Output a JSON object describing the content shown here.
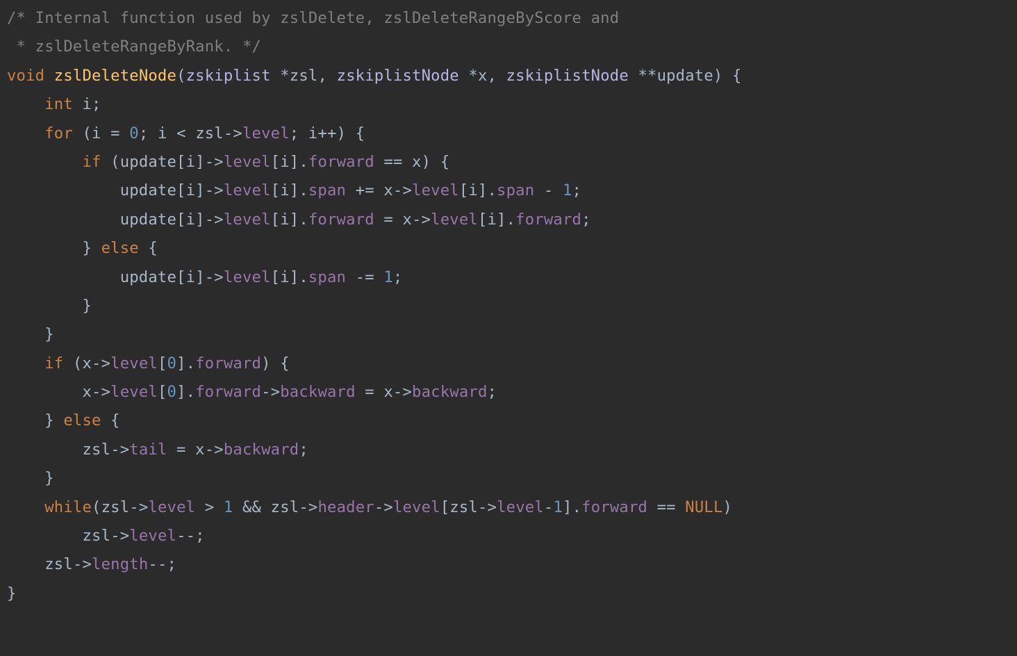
{
  "colors": {
    "background": "#2b2b2b",
    "default": "#a9b7c6",
    "comment": "#808080",
    "keyword": "#cc8242",
    "function": "#ffc66d",
    "type": "#b5b6e3",
    "field": "#9876aa",
    "number": "#6897bb"
  },
  "code": {
    "lines": [
      {
        "tokens": [
          {
            "cls": "comment",
            "t": "/* Internal function used by zslDelete, zslDeleteRangeByScore and"
          }
        ]
      },
      {
        "tokens": [
          {
            "cls": "comment",
            "t": " * zslDeleteRangeByRank. */"
          }
        ]
      },
      {
        "tokens": [
          {
            "cls": "kw",
            "t": "void"
          },
          {
            "cls": "base",
            "t": " "
          },
          {
            "cls": "fn",
            "t": "zslDeleteNode"
          },
          {
            "cls": "base",
            "t": "("
          },
          {
            "cls": "type",
            "t": "zskiplist"
          },
          {
            "cls": "base",
            "t": " *zsl, "
          },
          {
            "cls": "type",
            "t": "zskiplistNode"
          },
          {
            "cls": "base",
            "t": " *x, "
          },
          {
            "cls": "type",
            "t": "zskiplistNode"
          },
          {
            "cls": "base",
            "t": " **update) {"
          }
        ]
      },
      {
        "tokens": [
          {
            "cls": "base",
            "t": "    "
          },
          {
            "cls": "kw",
            "t": "int"
          },
          {
            "cls": "base",
            "t": " i;"
          }
        ]
      },
      {
        "tokens": [
          {
            "cls": "base",
            "t": "    "
          },
          {
            "cls": "kw",
            "t": "for"
          },
          {
            "cls": "base",
            "t": " (i = "
          },
          {
            "cls": "num",
            "t": "0"
          },
          {
            "cls": "base",
            "t": "; i < zsl->"
          },
          {
            "cls": "field",
            "t": "level"
          },
          {
            "cls": "base",
            "t": "; i++) {"
          }
        ]
      },
      {
        "tokens": [
          {
            "cls": "base",
            "t": "        "
          },
          {
            "cls": "kw",
            "t": "if"
          },
          {
            "cls": "base",
            "t": " (update[i]->"
          },
          {
            "cls": "field",
            "t": "level"
          },
          {
            "cls": "base",
            "t": "[i]."
          },
          {
            "cls": "field",
            "t": "forward"
          },
          {
            "cls": "base",
            "t": " == x) {"
          }
        ]
      },
      {
        "tokens": [
          {
            "cls": "base",
            "t": "            update[i]->"
          },
          {
            "cls": "field",
            "t": "level"
          },
          {
            "cls": "base",
            "t": "[i]."
          },
          {
            "cls": "field",
            "t": "span"
          },
          {
            "cls": "base",
            "t": " += x->"
          },
          {
            "cls": "field",
            "t": "level"
          },
          {
            "cls": "base",
            "t": "[i]."
          },
          {
            "cls": "field",
            "t": "span"
          },
          {
            "cls": "base",
            "t": " - "
          },
          {
            "cls": "num",
            "t": "1"
          },
          {
            "cls": "base",
            "t": ";"
          }
        ]
      },
      {
        "tokens": [
          {
            "cls": "base",
            "t": "            update[i]->"
          },
          {
            "cls": "field",
            "t": "level"
          },
          {
            "cls": "base",
            "t": "[i]."
          },
          {
            "cls": "field",
            "t": "forward"
          },
          {
            "cls": "base",
            "t": " = x->"
          },
          {
            "cls": "field",
            "t": "level"
          },
          {
            "cls": "base",
            "t": "[i]."
          },
          {
            "cls": "field",
            "t": "forward"
          },
          {
            "cls": "base",
            "t": ";"
          }
        ]
      },
      {
        "tokens": [
          {
            "cls": "base",
            "t": "        } "
          },
          {
            "cls": "kw",
            "t": "else"
          },
          {
            "cls": "base",
            "t": " {"
          }
        ]
      },
      {
        "tokens": [
          {
            "cls": "base",
            "t": "            update[i]->"
          },
          {
            "cls": "field",
            "t": "level"
          },
          {
            "cls": "base",
            "t": "[i]."
          },
          {
            "cls": "field",
            "t": "span"
          },
          {
            "cls": "base",
            "t": " -= "
          },
          {
            "cls": "num",
            "t": "1"
          },
          {
            "cls": "base",
            "t": ";"
          }
        ]
      },
      {
        "tokens": [
          {
            "cls": "base",
            "t": "        }"
          }
        ]
      },
      {
        "tokens": [
          {
            "cls": "base",
            "t": "    }"
          }
        ]
      },
      {
        "tokens": [
          {
            "cls": "base",
            "t": "    "
          },
          {
            "cls": "kw",
            "t": "if"
          },
          {
            "cls": "base",
            "t": " (x->"
          },
          {
            "cls": "field",
            "t": "level"
          },
          {
            "cls": "base",
            "t": "["
          },
          {
            "cls": "num",
            "t": "0"
          },
          {
            "cls": "base",
            "t": "]."
          },
          {
            "cls": "field",
            "t": "forward"
          },
          {
            "cls": "base",
            "t": ") {"
          }
        ]
      },
      {
        "tokens": [
          {
            "cls": "base",
            "t": "        x->"
          },
          {
            "cls": "field",
            "t": "level"
          },
          {
            "cls": "base",
            "t": "["
          },
          {
            "cls": "num",
            "t": "0"
          },
          {
            "cls": "base",
            "t": "]."
          },
          {
            "cls": "field",
            "t": "forward"
          },
          {
            "cls": "base",
            "t": "->"
          },
          {
            "cls": "field",
            "t": "backward"
          },
          {
            "cls": "base",
            "t": " = x->"
          },
          {
            "cls": "field",
            "t": "backward"
          },
          {
            "cls": "base",
            "t": ";"
          }
        ]
      },
      {
        "tokens": [
          {
            "cls": "base",
            "t": "    } "
          },
          {
            "cls": "kw",
            "t": "else"
          },
          {
            "cls": "base",
            "t": " {"
          }
        ]
      },
      {
        "tokens": [
          {
            "cls": "base",
            "t": "        zsl->"
          },
          {
            "cls": "field",
            "t": "tail"
          },
          {
            "cls": "base",
            "t": " = x->"
          },
          {
            "cls": "field",
            "t": "backward"
          },
          {
            "cls": "base",
            "t": ";"
          }
        ]
      },
      {
        "tokens": [
          {
            "cls": "base",
            "t": "    }"
          }
        ]
      },
      {
        "tokens": [
          {
            "cls": "base",
            "t": "    "
          },
          {
            "cls": "kw",
            "t": "while"
          },
          {
            "cls": "base",
            "t": "(zsl->"
          },
          {
            "cls": "field",
            "t": "level"
          },
          {
            "cls": "base",
            "t": " > "
          },
          {
            "cls": "num",
            "t": "1"
          },
          {
            "cls": "base",
            "t": " && zsl->"
          },
          {
            "cls": "field",
            "t": "header"
          },
          {
            "cls": "base",
            "t": "->"
          },
          {
            "cls": "field",
            "t": "level"
          },
          {
            "cls": "base",
            "t": "[zsl->"
          },
          {
            "cls": "field",
            "t": "level"
          },
          {
            "cls": "base",
            "t": "-"
          },
          {
            "cls": "num",
            "t": "1"
          },
          {
            "cls": "base",
            "t": "]."
          },
          {
            "cls": "field",
            "t": "forward"
          },
          {
            "cls": "base",
            "t": " == "
          },
          {
            "cls": "null",
            "t": "NULL"
          },
          {
            "cls": "base",
            "t": ")"
          }
        ]
      },
      {
        "tokens": [
          {
            "cls": "base",
            "t": "        zsl->"
          },
          {
            "cls": "field",
            "t": "level"
          },
          {
            "cls": "base",
            "t": "--;"
          }
        ]
      },
      {
        "tokens": [
          {
            "cls": "base",
            "t": "    zsl->"
          },
          {
            "cls": "field",
            "t": "length"
          },
          {
            "cls": "base",
            "t": "--;"
          }
        ]
      },
      {
        "tokens": [
          {
            "cls": "base",
            "t": "}"
          }
        ]
      }
    ]
  }
}
